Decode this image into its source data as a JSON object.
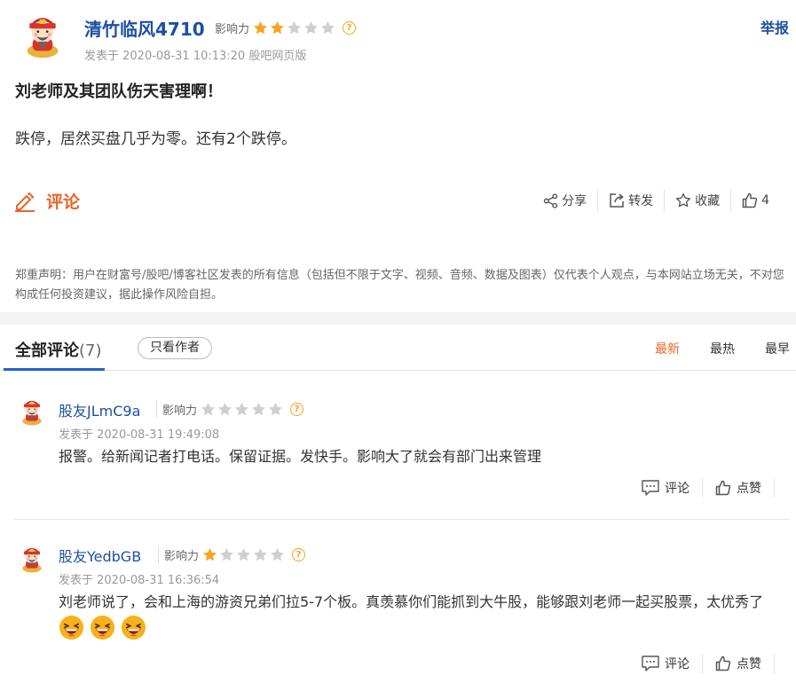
{
  "post": {
    "author": "清竹临风4710",
    "influence_label": "影响力",
    "influence_stars": 2,
    "meta": "发表于 2020-08-31 10:13:20 股吧网页版",
    "report": "举报",
    "title": "刘老师及其团队伤天害理啊！",
    "body": "跌停，居然买盘几乎为零。还有2个跌停。",
    "comment_label": "评论",
    "actions": {
      "share": "分享",
      "forward": "转发",
      "favorite": "收藏",
      "likes": "4"
    },
    "disclaimer": "郑重声明：用户在财富号/股吧/博客社区发表的所有信息（包括但不限于文字、视频、音频、数据及图表）仅代表个人观点，与本网站立场无关，不对您构成任何投资建议，据此操作风险自担。"
  },
  "comments_section": {
    "title": "全部评论",
    "count": "(7)",
    "only_author": "只看作者",
    "sort": {
      "latest": "最新",
      "hottest": "最热",
      "earliest": "最早"
    }
  },
  "replies": [
    {
      "author": "股友JLmC9a",
      "influence_label": "影响力",
      "influence_stars": 0,
      "meta": "发表于 2020-08-31 19:49:08",
      "text": "报警。给新闻记者打电话。保留证据。发快手。影响大了就会有部门出来管理",
      "emoji_count": 0,
      "comment": "评论",
      "like": "点赞"
    },
    {
      "author": "股友YedbGB",
      "influence_label": "影响力",
      "influence_stars": 1,
      "meta": "发表于 2020-08-31 16:36:54",
      "text": "刘老师说了，会和上海的游资兄弟们拉5-7个板。真羡慕你们能抓到大牛股，能够跟刘老师一起买股票，太优秀了",
      "emoji_count": 3,
      "comment": "评论",
      "like": "点赞"
    }
  ],
  "colors": {
    "accent_orange": "#e8652b",
    "link_blue": "#1e4fa3",
    "star_on": "#f5a623",
    "star_off": "#cfcfcf"
  }
}
